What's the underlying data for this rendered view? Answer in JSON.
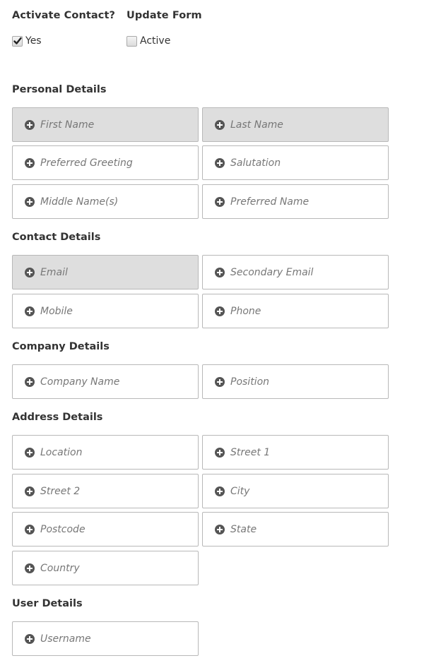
{
  "top": {
    "activate": {
      "heading": "Activate Contact?",
      "option_label": "Yes",
      "checked": true
    },
    "update": {
      "heading": "Update Form",
      "option_label": "Active",
      "checked": false
    }
  },
  "sections": {
    "personal": {
      "title": "Personal Details",
      "fields": [
        "First Name",
        "Last Name",
        "Preferred Greeting",
        "Salutation",
        "Middle Name(s)",
        "Preferred Name"
      ]
    },
    "contact": {
      "title": "Contact Details",
      "fields": [
        "Email",
        "Secondary Email",
        "Mobile",
        "Phone"
      ]
    },
    "company": {
      "title": "Company Details",
      "fields": [
        "Company Name",
        "Position"
      ]
    },
    "address": {
      "title": "Address Details",
      "fields": [
        "Location",
        "Street 1",
        "Street 2",
        "City",
        "Postcode",
        "State",
        "Country"
      ]
    },
    "user": {
      "title": "User Details",
      "fields": [
        "Username"
      ]
    }
  },
  "icons": {
    "field_add": "plus-circle-icon",
    "check": "checkmark-icon"
  },
  "colors": {
    "filled_field_bg": "#dedede",
    "field_border": "#b8b8b8",
    "icon": "#555555",
    "placeholder_text": "#777777"
  }
}
